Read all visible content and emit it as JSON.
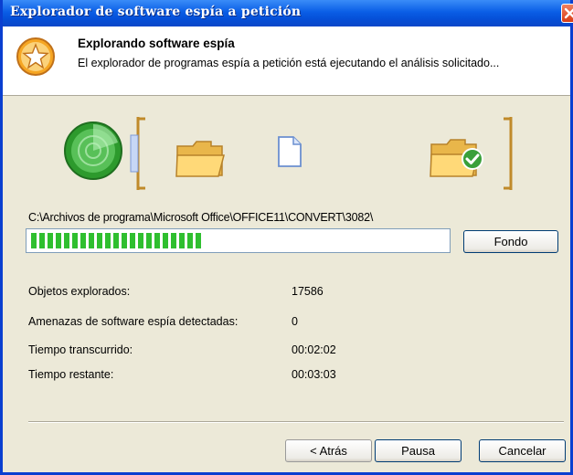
{
  "window": {
    "title": "Explorador de software espía a petición"
  },
  "header": {
    "title": "Explorando software espía",
    "subtitle": "El explorador de programas espía a petición está ejecutando el análisis solicitado..."
  },
  "icons": {
    "header": "star-badge-icon",
    "scanner": "radar-scan-icon",
    "folder": "folder-icon",
    "document": "document-icon",
    "folder_checked": "folder-check-icon"
  },
  "scan": {
    "current_path": "C:\\Archivos de programa\\Microsoft Office\\OFFICE11\\CONVERT\\3082\\",
    "progress_percent": 41,
    "background_button": "Fondo"
  },
  "stats": [
    {
      "label": "Objetos explorados:",
      "value": "17586"
    },
    {
      "label": "Amenazas de software espía detectadas:",
      "value": "0"
    },
    {
      "label": "Tiempo transcurrido:",
      "value": "00:02:02"
    },
    {
      "label": "Tiempo restante:",
      "value": "00:03:03"
    }
  ],
  "footer": {
    "back": "< Atrás",
    "pause": "Pausa",
    "cancel": "Cancelar"
  },
  "colors": {
    "titlebar": "#0a5ee6",
    "progress": "#2fbf2f",
    "dialog": "#ece9d8"
  }
}
